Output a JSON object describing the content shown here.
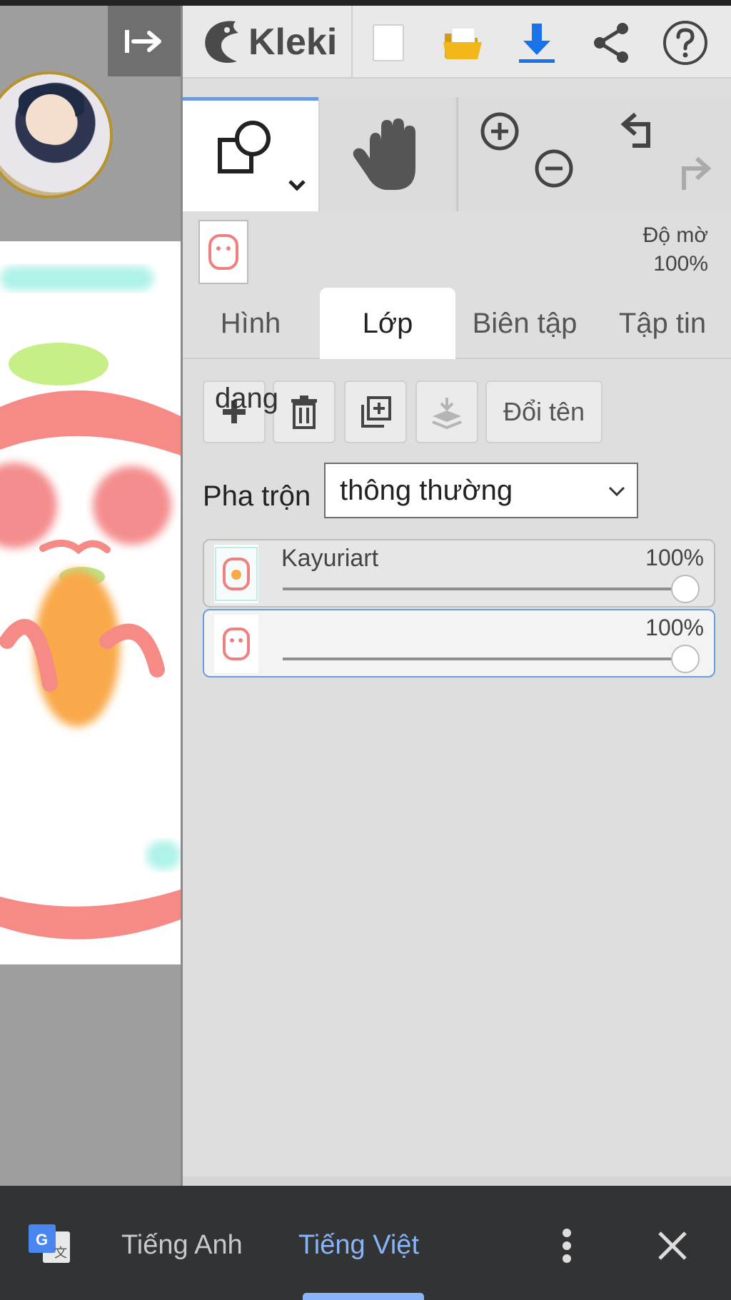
{
  "app": {
    "logo_text": "Kleki",
    "colors": {
      "accent": "#6c9bdf",
      "download_blue": "#1a73e8",
      "folder_yellow": "#f2b81a",
      "translate_blue": "#8ab4f8"
    }
  },
  "topbar": {
    "buttons": [
      {
        "name": "new-image",
        "icon": "new-document-icon"
      },
      {
        "name": "open",
        "icon": "folder-open-icon"
      },
      {
        "name": "download",
        "icon": "download-icon"
      },
      {
        "name": "share",
        "icon": "share-icon"
      },
      {
        "name": "help",
        "icon": "help-icon"
      }
    ]
  },
  "layer_preview": {
    "opacity_label": "Độ mờ",
    "opacity_value": "100%"
  },
  "tabs": [
    {
      "label": "Hình",
      "active": false
    },
    {
      "label": "Lớp",
      "active": true
    },
    {
      "label": "Biên tập",
      "active": false
    },
    {
      "label": "Tập tin",
      "active": false
    }
  ],
  "layer_actions": {
    "overlay_text": "dang",
    "rename_label": "Đổi tên"
  },
  "blend": {
    "label": "Pha trộn",
    "value": "thông thường"
  },
  "layers": [
    {
      "name": "Kayuriart",
      "opacity_text": "100%",
      "opacity": 1.0,
      "selected": false
    },
    {
      "name": "",
      "opacity_text": "100%",
      "opacity": 1.0,
      "selected": true
    }
  ],
  "translate_bar": {
    "source_lang": "Tiếng Anh",
    "target_lang": "Tiếng Việt"
  }
}
